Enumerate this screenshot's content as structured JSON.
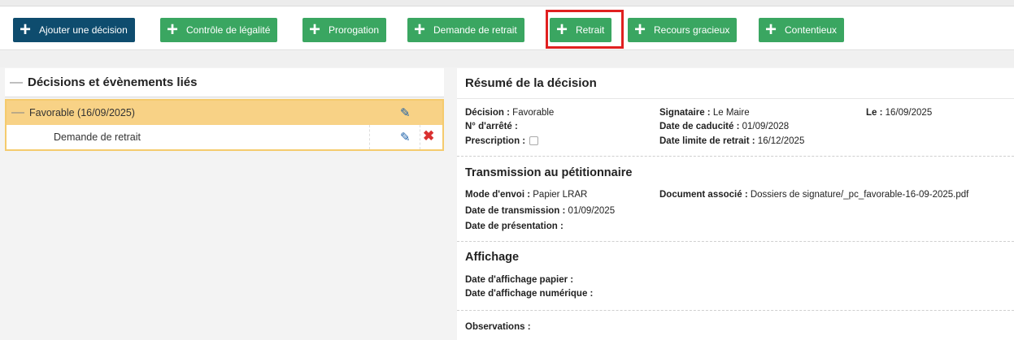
{
  "toolbar": {
    "buttons": [
      {
        "label": "Ajouter une décision",
        "style": "dark"
      },
      {
        "label": "Contrôle de légalité",
        "style": "green"
      },
      {
        "label": "Prorogation",
        "style": "green"
      },
      {
        "label": "Demande de retrait",
        "style": "green"
      },
      {
        "label": "Retrait",
        "style": "green"
      },
      {
        "label": "Recours gracieux",
        "style": "green"
      },
      {
        "label": "Contentieux",
        "style": "green"
      }
    ],
    "plus_glyph": "+"
  },
  "left_panel": {
    "title": "Décisions et évènements liés",
    "collapse_glyph": "—",
    "tree": {
      "parent": {
        "label": "Favorable (16/09/2025)"
      },
      "child": {
        "label": "Demande de retrait"
      }
    }
  },
  "right_panel": {
    "title": "Résumé de la décision",
    "decision": {
      "decision_key": "Décision :",
      "decision_val": "Favorable",
      "arrete_key": "N° d'arrêté :",
      "arrete_val": "",
      "prescription_key": "Prescription :",
      "signataire_key": "Signataire :",
      "signataire_val": "Le Maire",
      "caducite_key": "Date de caducité :",
      "caducite_val": "01/09/2028",
      "retrait_key": "Date limite de retrait :",
      "retrait_val": "16/12/2025",
      "le_key": "Le :",
      "le_val": "16/09/2025"
    },
    "transmission": {
      "title": "Transmission au pétitionnaire",
      "mode_key": "Mode d'envoi :",
      "mode_val": "Papier LRAR",
      "date_trans_key": "Date de transmission :",
      "date_trans_val": "01/09/2025",
      "date_pres_key": "Date de présentation :",
      "date_pres_val": "",
      "doc_key": "Document associé :",
      "doc_val": "Dossiers de signature/_pc_favorable-16-09-2025.pdf"
    },
    "affichage": {
      "title": "Affichage",
      "papier_key": "Date d'affichage papier :",
      "papier_val": "",
      "numerique_key": "Date d'affichage numérique :",
      "numerique_val": ""
    },
    "observations": {
      "key": "Observations :",
      "val": ""
    }
  },
  "colors": {
    "dark_button": "#0e4c6e",
    "green_button": "#3aa661",
    "highlight": "#e02020",
    "tree_active": "#f8d286"
  },
  "icons": [
    "plus-icon",
    "minus-icon",
    "pencil-icon",
    "close-icon",
    "checkbox-icon"
  ]
}
